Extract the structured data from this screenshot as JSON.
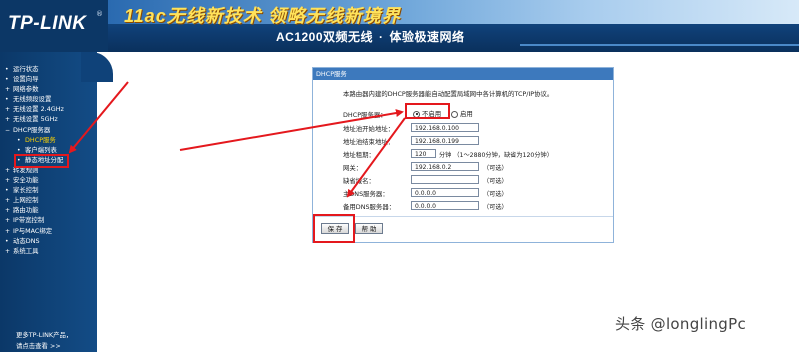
{
  "header": {
    "logo": "TP-LINK",
    "logo_reg": "®",
    "slogan": "11ac无线新技术 领略无线新境界",
    "sub_left": "AC1200双频无线",
    "sub_dot": "·",
    "sub_right": "体验极速网络"
  },
  "sidebar": {
    "items": [
      {
        "label": "运行状态",
        "bullet": "•"
      },
      {
        "label": "设置向导",
        "bullet": "•"
      },
      {
        "label": "网络参数",
        "bullet": "+"
      },
      {
        "label": "无线频段设置",
        "bullet": "•"
      },
      {
        "label": "无线设置 2.4GHz",
        "bullet": "+"
      },
      {
        "label": "无线设置 5GHz",
        "bullet": "+"
      },
      {
        "label": "DHCP服务器",
        "bullet": "−"
      },
      {
        "label": "DHCP服务",
        "bullet": "•",
        "sub": true,
        "active": true
      },
      {
        "label": "客户端列表",
        "bullet": "•",
        "sub": true
      },
      {
        "label": "静态地址分配",
        "bullet": "•",
        "sub": true
      },
      {
        "label": "转发规则",
        "bullet": "+"
      },
      {
        "label": "安全功能",
        "bullet": "+"
      },
      {
        "label": "家长控制",
        "bullet": "•"
      },
      {
        "label": "上网控制",
        "bullet": "+"
      },
      {
        "label": "路由功能",
        "bullet": "+"
      },
      {
        "label": "IP带宽控制",
        "bullet": "+"
      },
      {
        "label": "IP与MAC绑定",
        "bullet": "+"
      },
      {
        "label": "动态DNS",
        "bullet": "•"
      },
      {
        "label": "系统工具",
        "bullet": "+"
      }
    ],
    "footer_line1": "更多TP-LINK产品，",
    "footer_line2": "请点击查看 >>"
  },
  "panel": {
    "title": "DHCP服务",
    "intro": "本路由器内建的DHCP服务器能自动配置局域网中各计算机的TCP/IP协议。",
    "dhcp_label": "DHCP服务器：",
    "opt_disable": "不启用",
    "opt_enable": "启用",
    "dhcp_selected": "不启用",
    "start_label": "地址池开始地址：",
    "start_value": "192.168.0.100",
    "end_label": "地址池结束地址：",
    "end_value": "192.168.0.199",
    "lease_label": "地址租期：",
    "lease_value": "120",
    "lease_note": "分钟 （1～2880分钟，缺省为120分钟）",
    "gateway_label": "网关：",
    "gateway_value": "192.168.0.2",
    "gateway_note": "（可选）",
    "domain_label": "缺省域名：",
    "domain_value": "",
    "domain_note": "（可选）",
    "dns1_label": "主DNS服务器：",
    "dns1_value": "0.0.0.0",
    "dns1_note": "（可选）",
    "dns2_label": "备用DNS服务器：",
    "dns2_value": "0.0.0.0",
    "dns2_note": "（可选）",
    "save": "保 存",
    "help": "帮 助"
  },
  "watermark": "头条 @longlingPc",
  "colors": {
    "header_blue": "#0f3f76",
    "sidebar_blue": "#0b3868",
    "panel_title": "#3d79bd",
    "annotation_red": "#e4181d",
    "slogan_yellow": "#ffe25a"
  }
}
